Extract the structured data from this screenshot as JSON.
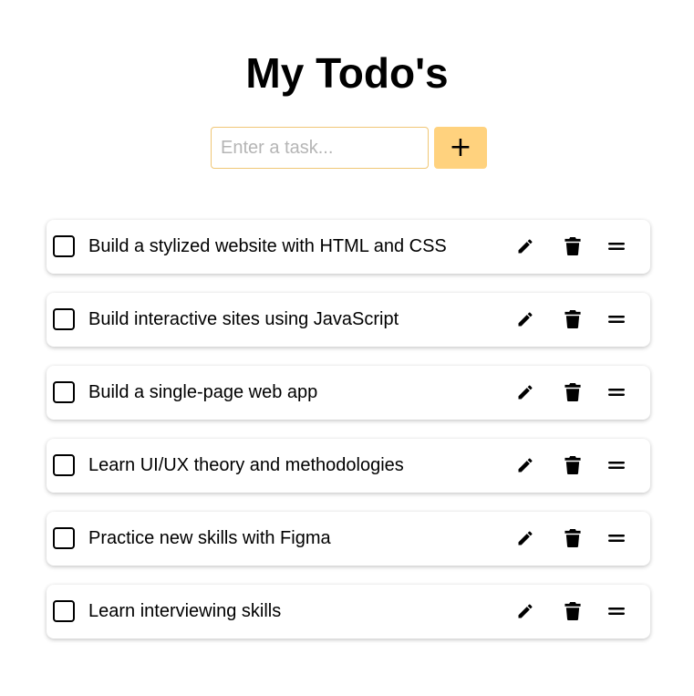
{
  "header": {
    "title": "My Todo's"
  },
  "add_form": {
    "placeholder": "Enter a task...",
    "value": "",
    "add_label": "+"
  },
  "todos": [
    {
      "text": "Build a stylized website with HTML and CSS",
      "done": false
    },
    {
      "text": "Build interactive sites using JavaScript",
      "done": false
    },
    {
      "text": "Build a single-page web app",
      "done": false
    },
    {
      "text": "Learn UI/UX theory and methodologies",
      "done": false
    },
    {
      "text": "Practice new skills with Figma",
      "done": false
    },
    {
      "text": "Learn interviewing skills",
      "done": false
    }
  ],
  "icons": {
    "edit": "pencil-icon",
    "delete": "trash-icon",
    "drag": "drag-handle-icon"
  },
  "colors": {
    "accent": "#ffd27e",
    "input_border": "#f0c776",
    "text": "#000000",
    "background": "#ffffff"
  }
}
